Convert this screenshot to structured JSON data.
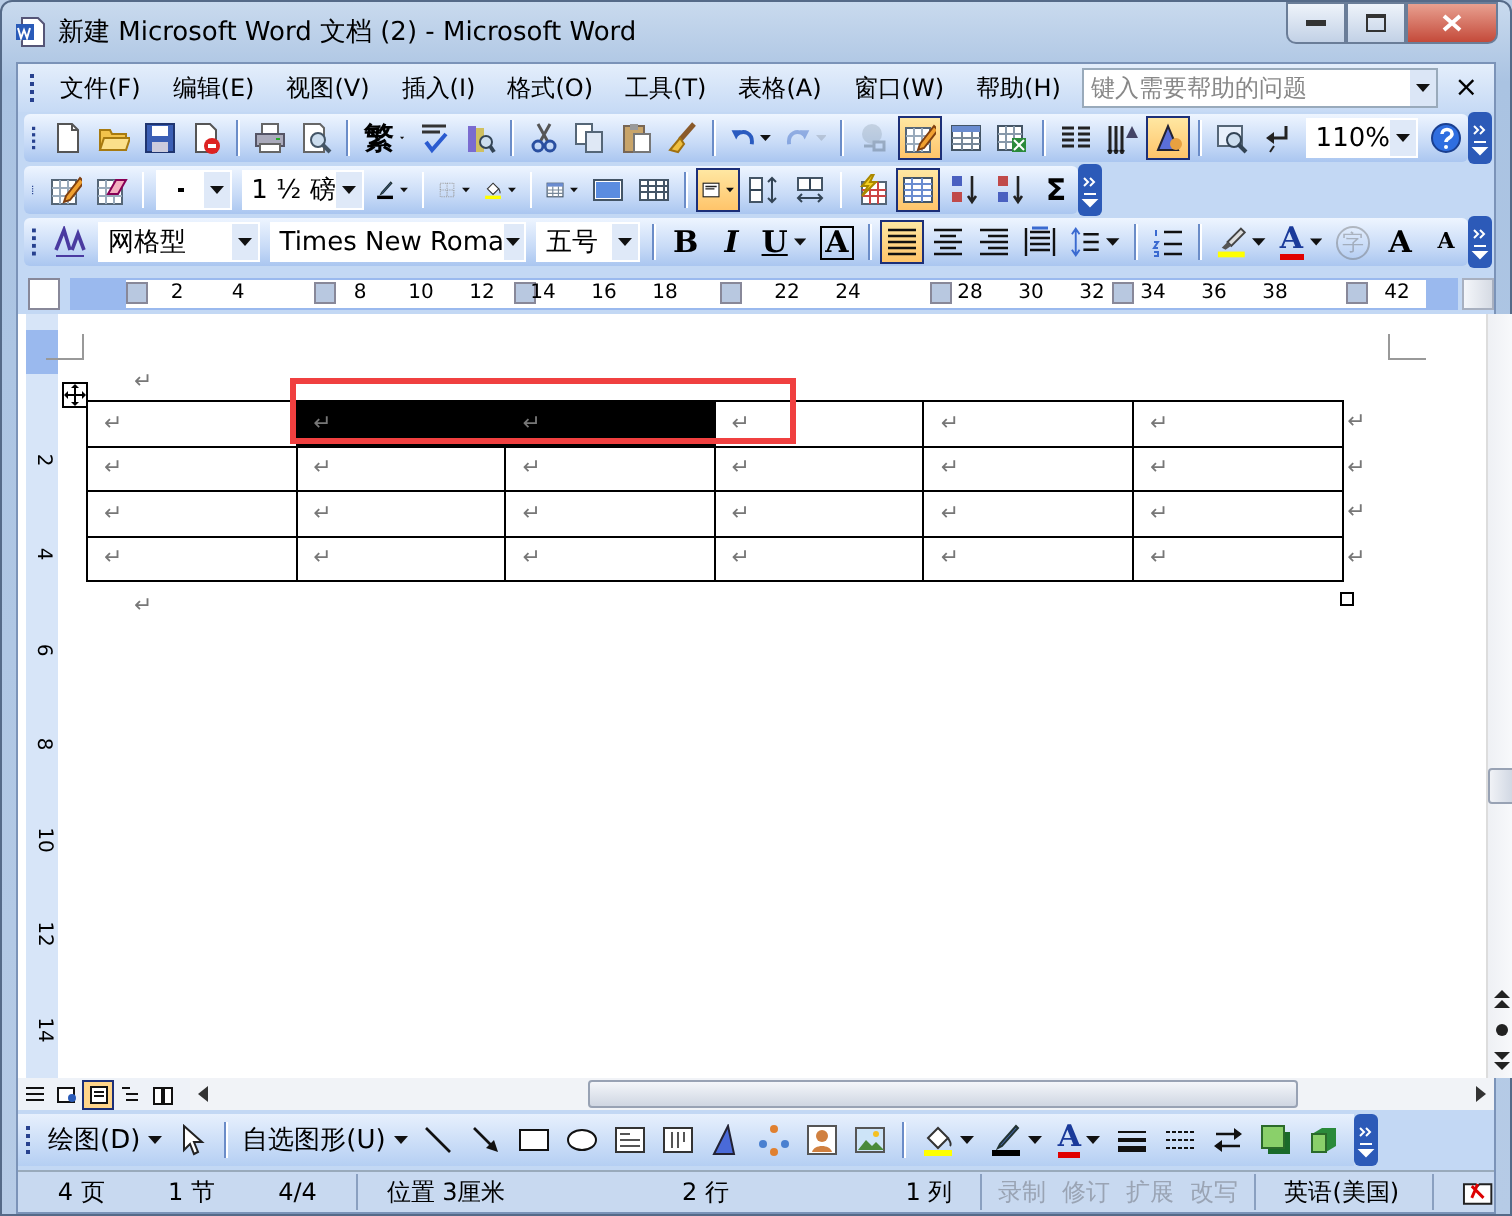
{
  "window": {
    "title": "新建 Microsoft Word 文档 (2) - Microsoft Word"
  },
  "menu_bar": {
    "items": [
      "文件(F)",
      "编辑(E)",
      "视图(V)",
      "插入(I)",
      "格式(O)",
      "工具(T)",
      "表格(A)",
      "窗口(W)",
      "帮助(H)"
    ],
    "help_box": {
      "placeholder": "键入需要帮助的问题"
    },
    "close_glyph": "×"
  },
  "standard_toolbar": [
    {
      "kind": "icon",
      "pressed": false,
      "disabled": false,
      "dropdown": false
    },
    {
      "kind": "icon",
      "pressed": false,
      "disabled": false,
      "dropdown": false
    },
    {
      "kind": "icon",
      "pressed": false,
      "disabled": false,
      "dropdown": false
    },
    {
      "kind": "icon",
      "pressed": false,
      "disabled": false,
      "dropdown": false
    },
    {
      "kind": "separator"
    },
    {
      "kind": "icon",
      "pressed": false,
      "disabled": false,
      "dropdown": false
    },
    {
      "kind": "icon",
      "pressed": false,
      "disabled": false,
      "dropdown": false
    },
    {
      "kind": "separator"
    },
    {
      "kind": "glyph",
      "text": "繁",
      "pressed": false,
      "disabled": false,
      "dropdown": true
    },
    {
      "kind": "icon",
      "pressed": false,
      "disabled": false,
      "dropdown": false
    },
    {
      "kind": "icon",
      "pressed": false,
      "disabled": false,
      "dropdown": false
    },
    {
      "kind": "separator"
    },
    {
      "kind": "icon",
      "pressed": false,
      "disabled": false,
      "dropdown": false
    },
    {
      "kind": "icon",
      "pressed": false,
      "disabled": false,
      "dropdown": false
    },
    {
      "kind": "icon",
      "pressed": false,
      "disabled": false,
      "dropdown": false
    },
    {
      "kind": "icon",
      "pressed": false,
      "disabled": false,
      "dropdown": false
    },
    {
      "kind": "separator"
    },
    {
      "kind": "icon",
      "pressed": false,
      "disabled": false,
      "dropdown": true
    },
    {
      "kind": "icon",
      "pressed": false,
      "disabled": true,
      "dropdown": true
    },
    {
      "kind": "separator"
    },
    {
      "kind": "icon",
      "pressed": false,
      "disabled": true,
      "dropdown": false
    },
    {
      "kind": "icon",
      "pressed": true,
      "disabled": false,
      "dropdown": false
    },
    {
      "kind": "icon",
      "pressed": false,
      "disabled": false,
      "dropdown": false
    },
    {
      "kind": "icon",
      "pressed": false,
      "disabled": false,
      "dropdown": false
    },
    {
      "kind": "separator"
    },
    {
      "kind": "icon",
      "pressed": false,
      "disabled": false,
      "dropdown": false
    },
    {
      "kind": "icon",
      "pressed": false,
      "disabled": false,
      "dropdown": false
    },
    {
      "kind": "icon",
      "pressed": true,
      "disabled": false,
      "dropdown": false
    },
    {
      "kind": "separator"
    },
    {
      "kind": "icon",
      "pressed": false,
      "disabled": false,
      "dropdown": false
    },
    {
      "kind": "icon",
      "pressed": false,
      "disabled": false,
      "dropdown": false
    },
    {
      "kind": "combo",
      "value": "110%"
    },
    {
      "kind": "icon",
      "pressed": false,
      "disabled": false,
      "dropdown": false
    }
  ],
  "tables_toolbar": [
    {
      "kind": "icon",
      "pressed": false,
      "disabled": false,
      "dropdown": false
    },
    {
      "kind": "icon",
      "pressed": false,
      "disabled": false,
      "dropdown": false
    },
    {
      "kind": "separator"
    },
    {
      "kind": "line_combo"
    },
    {
      "kind": "combo",
      "value": "1 ½ 磅"
    },
    {
      "kind": "icon",
      "pressed": false,
      "disabled": false,
      "dropdown": true
    },
    {
      "kind": "separator"
    },
    {
      "kind": "icon",
      "pressed": false,
      "disabled": false,
      "dropdown": true
    },
    {
      "kind": "icon",
      "pressed": false,
      "disabled": false,
      "dropdown": true
    },
    {
      "kind": "separator"
    },
    {
      "kind": "icon",
      "pressed": false,
      "disabled": false,
      "dropdown": true
    },
    {
      "kind": "icon",
      "pressed": false,
      "disabled": false,
      "dropdown": false
    },
    {
      "kind": "icon",
      "pressed": false,
      "disabled": false,
      "dropdown": false
    },
    {
      "kind": "separator"
    },
    {
      "kind": "icon",
      "pressed": true,
      "disabled": false,
      "dropdown": true
    },
    {
      "kind": "icon",
      "pressed": false,
      "disabled": false,
      "dropdown": false
    },
    {
      "kind": "icon",
      "pressed": false,
      "disabled": false,
      "dropdown": false
    },
    {
      "kind": "separator"
    },
    {
      "kind": "icon",
      "pressed": false,
      "disabled": false,
      "dropdown": false
    },
    {
      "kind": "icon",
      "pressed": true,
      "disabled": false,
      "dropdown": false
    },
    {
      "kind": "icon",
      "pressed": false,
      "disabled": false,
      "dropdown": false
    },
    {
      "kind": "icon",
      "pressed": false,
      "disabled": false,
      "dropdown": false
    },
    {
      "kind": "glyph",
      "text": "Σ",
      "pressed": false,
      "disabled": false,
      "dropdown": false
    }
  ],
  "formatting_toolbar": [
    {
      "kind": "icon",
      "pressed": false,
      "disabled": false,
      "dropdown": false
    },
    {
      "kind": "combo",
      "value": "网格型"
    },
    {
      "kind": "combo",
      "value": "Times New Roma"
    },
    {
      "kind": "combo",
      "value": "五号"
    },
    {
      "kind": "separator"
    },
    {
      "kind": "glyph",
      "text": "B",
      "pressed": false,
      "disabled": false,
      "dropdown": false
    },
    {
      "kind": "glyph",
      "text": "I",
      "pressed": false,
      "disabled": false,
      "dropdown": false
    },
    {
      "kind": "glyph",
      "text": "U",
      "pressed": false,
      "disabled": false,
      "dropdown": true
    },
    {
      "kind": "glyph",
      "text": "A",
      "pressed": false,
      "disabled": false,
      "dropdown": false
    },
    {
      "kind": "separator"
    },
    {
      "kind": "icon",
      "pressed": true,
      "disabled": false,
      "dropdown": false
    },
    {
      "kind": "icon",
      "pressed": false,
      "disabled": false,
      "dropdown": false
    },
    {
      "kind": "icon",
      "pressed": false,
      "disabled": false,
      "dropdown": false
    },
    {
      "kind": "icon",
      "pressed": false,
      "disabled": false,
      "dropdown": false
    },
    {
      "kind": "icon",
      "pressed": false,
      "disabled": false,
      "dropdown": true
    },
    {
      "kind": "separator"
    },
    {
      "kind": "icon",
      "pressed": false,
      "disabled": false,
      "dropdown": false
    },
    {
      "kind": "separator"
    },
    {
      "kind": "icon",
      "pressed": false,
      "disabled": false,
      "dropdown": true
    },
    {
      "kind": "glyph",
      "text": "A",
      "pressed": false,
      "disabled": false,
      "dropdown": true
    },
    {
      "kind": "glyph",
      "text": "字",
      "pressed": false,
      "disabled": true,
      "dropdown": false
    },
    {
      "kind": "glyph",
      "text": "A",
      "pressed": false,
      "disabled": false,
      "dropdown": false
    },
    {
      "kind": "glyph",
      "text": "A",
      "pressed": false,
      "disabled": false,
      "dropdown": false
    }
  ],
  "ruler": {
    "numbers": [
      "2",
      "4",
      "8",
      "10",
      "12",
      "14",
      "16",
      "18",
      "22",
      "24",
      "28",
      "30",
      "32",
      "34",
      "36",
      "38",
      "42"
    ]
  },
  "vertical_ruler": {
    "numbers": [
      "2",
      "4",
      "6",
      "8",
      "10",
      "12",
      "14"
    ]
  },
  "document": {
    "mark_above": "↵",
    "mark_below": "↵",
    "callout_box": true,
    "table": {
      "rows": [
        {
          "end_mark": "↵",
          "cells": [
            {
              "text": "↵",
              "selected": false
            },
            {
              "text": "↵",
              "selected": true
            },
            {
              "text": "↵",
              "selected": true
            },
            {
              "text": "↵",
              "selected": false
            },
            {
              "text": "↵",
              "selected": false
            },
            {
              "text": "↵",
              "selected": false
            }
          ]
        },
        {
          "end_mark": "↵",
          "cells": [
            {
              "text": "↵",
              "selected": false
            },
            {
              "text": "↵",
              "selected": false
            },
            {
              "text": "↵",
              "selected": false
            },
            {
              "text": "↵",
              "selected": false
            },
            {
              "text": "↵",
              "selected": false
            },
            {
              "text": "↵",
              "selected": false
            }
          ]
        },
        {
          "end_mark": "↵",
          "cells": [
            {
              "text": "↵",
              "selected": false
            },
            {
              "text": "↵",
              "selected": false
            },
            {
              "text": "↵",
              "selected": false
            },
            {
              "text": "↵",
              "selected": false
            },
            {
              "text": "↵",
              "selected": false
            },
            {
              "text": "↵",
              "selected": false
            }
          ]
        },
        {
          "end_mark": "↵",
          "cells": [
            {
              "text": "↵",
              "selected": false
            },
            {
              "text": "↵",
              "selected": false
            },
            {
              "text": "↵",
              "selected": false
            },
            {
              "text": "↵",
              "selected": false
            },
            {
              "text": "↵",
              "selected": false
            },
            {
              "text": "↵",
              "selected": false
            }
          ]
        }
      ]
    }
  },
  "view_buttons": [
    {
      "selected": false
    },
    {
      "selected": false
    },
    {
      "selected": true
    },
    {
      "selected": false
    },
    {
      "selected": false
    }
  ],
  "drawing_toolbar": [
    {
      "kind": "menu",
      "text": "绘图(D)"
    },
    {
      "kind": "icon",
      "pressed": false,
      "disabled": false,
      "dropdown": false
    },
    {
      "kind": "separator"
    },
    {
      "kind": "menu",
      "text": "自选图形(U)"
    },
    {
      "kind": "icon",
      "pressed": false,
      "disabled": false,
      "dropdown": false
    },
    {
      "kind": "icon",
      "pressed": false,
      "disabled": false,
      "dropdown": false
    },
    {
      "kind": "icon",
      "pressed": false,
      "disabled": false,
      "dropdown": false
    },
    {
      "kind": "icon",
      "pressed": false,
      "disabled": false,
      "dropdown": false
    },
    {
      "kind": "icon",
      "pressed": false,
      "disabled": false,
      "dropdown": false
    },
    {
      "kind": "icon",
      "pressed": false,
      "disabled": false,
      "dropdown": false
    },
    {
      "kind": "icon",
      "pressed": false,
      "disabled": false,
      "dropdown": false
    },
    {
      "kind": "icon",
      "pressed": false,
      "disabled": false,
      "dropdown": false
    },
    {
      "kind": "icon",
      "pressed": false,
      "disabled": false,
      "dropdown": false
    },
    {
      "kind": "icon",
      "pressed": false,
      "disabled": false,
      "dropdown": false
    },
    {
      "kind": "separator"
    },
    {
      "kind": "icon",
      "pressed": false,
      "disabled": false,
      "dropdown": true
    },
    {
      "kind": "icon",
      "pressed": false,
      "disabled": false,
      "dropdown": true
    },
    {
      "kind": "glyph",
      "text": "A",
      "pressed": false,
      "disabled": false,
      "dropdown": true
    },
    {
      "kind": "icon",
      "pressed": false,
      "disabled": false,
      "dropdown": false
    },
    {
      "kind": "icon",
      "pressed": false,
      "disabled": false,
      "dropdown": false
    },
    {
      "kind": "icon",
      "pressed": false,
      "disabled": false,
      "dropdown": false
    },
    {
      "kind": "icon",
      "pressed": false,
      "disabled": false,
      "dropdown": false
    },
    {
      "kind": "icon",
      "pressed": false,
      "disabled": false,
      "dropdown": false
    }
  ],
  "status_bar": {
    "groups": [
      [
        {
          "text": "4 页",
          "disabled": false
        },
        {
          "text": "1 节",
          "disabled": false
        },
        {
          "text": "4/4",
          "disabled": false
        }
      ],
      [
        {
          "text": "位置 3厘米",
          "disabled": false
        },
        {
          "text": "2 行",
          "disabled": false
        },
        {
          "text": "1 列",
          "disabled": false
        }
      ],
      [
        {
          "text": "录制",
          "disabled": true
        },
        {
          "text": "修订",
          "disabled": true
        },
        {
          "text": "扩展",
          "disabled": true
        },
        {
          "text": "改写",
          "disabled": true
        }
      ],
      [
        {
          "text": "英语(美国)",
          "disabled": false
        }
      ]
    ]
  }
}
